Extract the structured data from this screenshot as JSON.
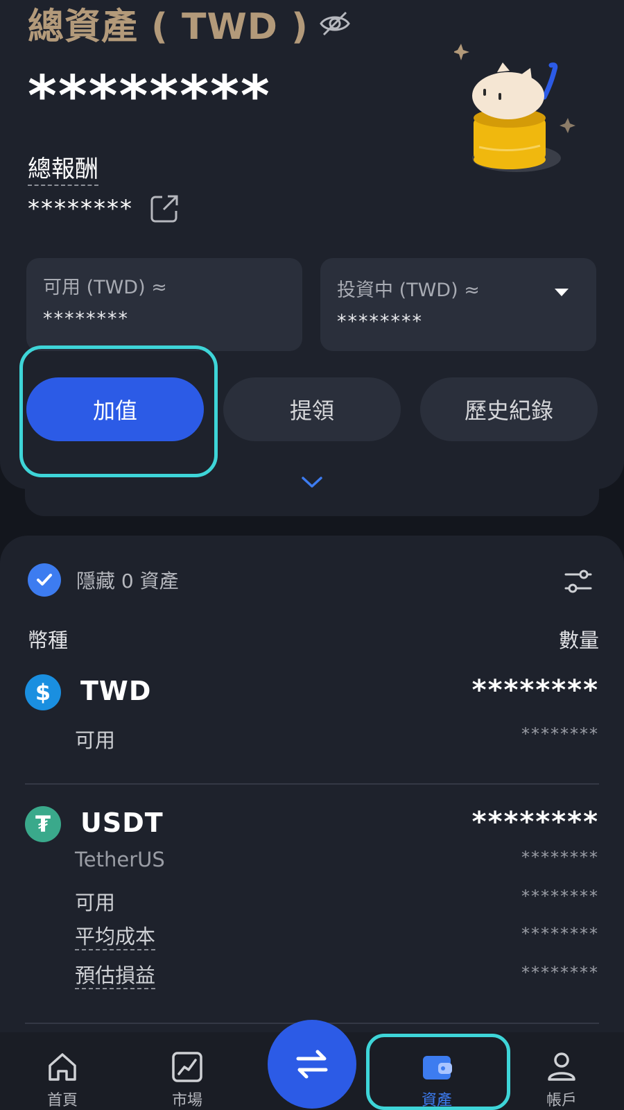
{
  "summary": {
    "title": "總資產 ( TWD )",
    "total_masked": "********",
    "reward_label": "總報酬",
    "reward_masked": "********",
    "available_label": "可用 (TWD) ≈",
    "available_masked": "********",
    "investing_label": "投資中 (TWD) ≈",
    "investing_masked": "********"
  },
  "actions": {
    "deposit": "加值",
    "withdraw": "提領",
    "history": "歷史紀錄"
  },
  "list": {
    "hide_label": "隱藏 0 資產",
    "col_currency": "幣種",
    "col_quantity": "數量"
  },
  "assets": [
    {
      "symbol": "TWD",
      "icon_glyph": "$",
      "icon_color": "#1a8fe0",
      "qty": "********",
      "rows": [
        {
          "label": "可用",
          "value": "********"
        }
      ]
    },
    {
      "symbol": "USDT",
      "icon_glyph": "₮",
      "icon_color": "#3aa98b",
      "qty": "********",
      "rows": [
        {
          "label": "TetherUS",
          "value": "********"
        },
        {
          "label": "可用",
          "value": "********"
        },
        {
          "label": "平均成本",
          "value": "********"
        },
        {
          "label": "預估損益",
          "value": "********"
        }
      ]
    }
  ],
  "nav": {
    "home": "首頁",
    "market": "市場",
    "assets": "資產",
    "account": "帳戶"
  },
  "colors": {
    "accent": "#2c5be6",
    "highlight": "#3ed5d8",
    "title_gold": "#b39a7a"
  },
  "icons": [
    "eye-off-icon",
    "external-link-icon",
    "chevron-down-icon",
    "check-icon",
    "filter-icon",
    "home-icon",
    "chart-icon",
    "swap-icon",
    "wallet-icon",
    "user-icon"
  ]
}
